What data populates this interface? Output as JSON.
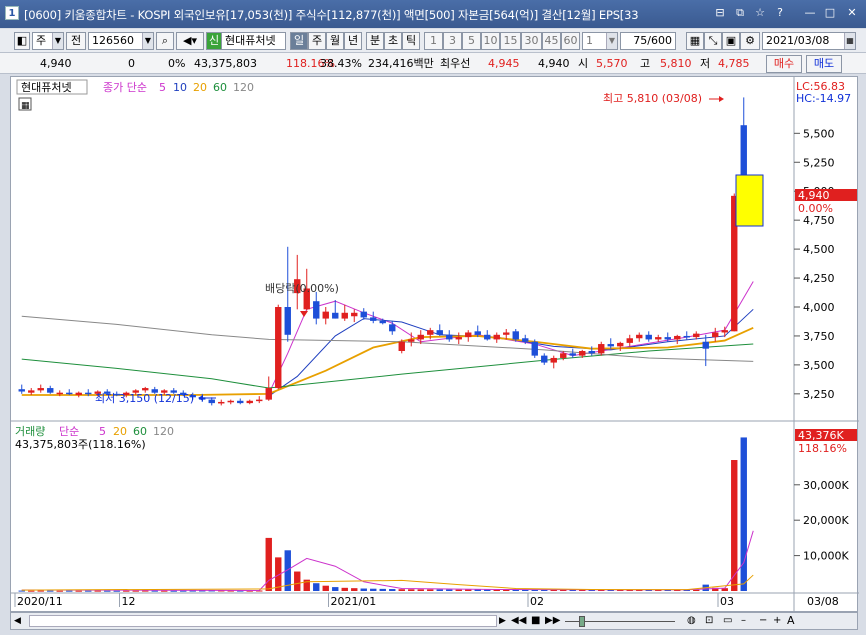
{
  "window": {
    "badge": "1",
    "title": "[0600] 키움종합차트 - KOSPI 외국인보유[17,053(천)] 주식수[112,877(천)] 액면[500] 자본금[564(억)] 결산[12월] EPS[33",
    "controls": [
      "⊟",
      "⧉",
      "☆",
      "?",
      "—",
      "□",
      "✕"
    ]
  },
  "toolbar": {
    "period": "주",
    "prev": "전",
    "code": "126560",
    "new_badge": "신",
    "stock_name": "현대퓨처넷",
    "intervals": [
      "일",
      "주",
      "월",
      "년",
      "분",
      "초",
      "틱"
    ],
    "numbers": [
      "1",
      "3",
      "5",
      "10",
      "15",
      "30",
      "45",
      "60"
    ],
    "count_value": "1",
    "page_count": "75/600",
    "date": "2021/03/08"
  },
  "summary": {
    "price": "4,940",
    "change": "0",
    "change_pct": "0%",
    "volume": "43,375,803",
    "vol_ratio": "118.16%",
    "turnover": "38.43%",
    "amount": "234,416백만",
    "pref_label": "최우선",
    "ask": "4,945",
    "bid": "4,940",
    "open_label": "시",
    "open": "5,570",
    "high_label": "고",
    "high": "5,810",
    "low_label": "저",
    "low": "4,785",
    "buy_label": "매수",
    "sell_label": "매도"
  },
  "price_panel": {
    "stock_tab": "현대퓨처넷",
    "ma_title": "종가 단순",
    "ma_periods": [
      "5",
      "10",
      "20",
      "60",
      "120"
    ],
    "lc": "LC:56.83",
    "hc": "HC:-14.97",
    "current_price": "4,940",
    "current_pct": "0.00%",
    "high_annotation": "최고 5,810 (03/08)",
    "low_annotation": "최저 3,150 (12/15)",
    "event_annotation": "배당락(0.00%)",
    "y_ticks": [
      "5,500",
      "5,250",
      "5,000",
      "4,750",
      "4,500",
      "4,250",
      "4,000",
      "3,750",
      "3,500",
      "3,250"
    ]
  },
  "volume_panel": {
    "title": "거래량",
    "ma_title": "단순",
    "ma_periods": [
      "5",
      "20",
      "60",
      "120"
    ],
    "info": "43,375,803주(118.16%)",
    "current_value": "43,376K",
    "current_pct": "118.16%",
    "y_ticks": [
      "30,000K",
      "20,000K",
      "10,000K"
    ]
  },
  "x_axis": {
    "labels": [
      "2020/11",
      "12",
      "2021/01",
      "02",
      "03",
      "03/08"
    ]
  },
  "colors": {
    "up": "#e0201f",
    "down": "#1e4fd8",
    "ma5": "#cc33cc",
    "ma10": "#1f3fbf",
    "ma20": "#e8a000",
    "ma60": "#1e8f3c",
    "ma120": "#888888"
  },
  "chart_data": {
    "type": "candlestick",
    "ohlc": [
      [
        3290,
        3330,
        3250,
        3270
      ],
      [
        3260,
        3300,
        3240,
        3280
      ],
      [
        3280,
        3330,
        3260,
        3300
      ],
      [
        3300,
        3320,
        3250,
        3260
      ],
      [
        3250,
        3280,
        3230,
        3260
      ],
      [
        3260,
        3290,
        3240,
        3250
      ],
      [
        3240,
        3270,
        3220,
        3260
      ],
      [
        3260,
        3290,
        3230,
        3250
      ],
      [
        3250,
        3280,
        3230,
        3270
      ],
      [
        3270,
        3290,
        3240,
        3250
      ],
      [
        3250,
        3270,
        3230,
        3240
      ],
      [
        3240,
        3270,
        3220,
        3260
      ],
      [
        3260,
        3290,
        3240,
        3280
      ],
      [
        3280,
        3310,
        3260,
        3300
      ],
      [
        3290,
        3310,
        3250,
        3260
      ],
      [
        3260,
        3290,
        3240,
        3280
      ],
      [
        3280,
        3300,
        3250,
        3260
      ],
      [
        3260,
        3280,
        3230,
        3240
      ],
      [
        3240,
        3260,
        3200,
        3220
      ],
      [
        3220,
        3250,
        3180,
        3200
      ],
      [
        3200,
        3220,
        3150,
        3170
      ],
      [
        3170,
        3200,
        3150,
        3180
      ],
      [
        3180,
        3200,
        3160,
        3190
      ],
      [
        3190,
        3210,
        3160,
        3170
      ],
      [
        3170,
        3200,
        3160,
        3190
      ],
      [
        3190,
        3230,
        3170,
        3200
      ],
      [
        3200,
        3400,
        3190,
        3300
      ],
      [
        3300,
        4020,
        3290,
        4000
      ],
      [
        4000,
        4520,
        3700,
        3760
      ],
      [
        4120,
        4450,
        3980,
        4240
      ],
      [
        3980,
        4330,
        3970,
        4160
      ],
      [
        4050,
        4130,
        3850,
        3900
      ],
      [
        3900,
        4000,
        3850,
        3960
      ],
      [
        3950,
        4060,
        3900,
        3900
      ],
      [
        3900,
        4020,
        3880,
        3950
      ],
      [
        3920,
        3980,
        3870,
        3950
      ],
      [
        3960,
        3990,
        3890,
        3910
      ],
      [
        3910,
        3960,
        3860,
        3880
      ],
      [
        3880,
        3900,
        3850,
        3860
      ],
      [
        3850,
        3880,
        3760,
        3790
      ],
      [
        3620,
        3720,
        3600,
        3700
      ],
      [
        3700,
        3780,
        3660,
        3720
      ],
      [
        3720,
        3800,
        3680,
        3760
      ],
      [
        3760,
        3820,
        3720,
        3800
      ],
      [
        3800,
        3850,
        3750,
        3760
      ],
      [
        3760,
        3800,
        3700,
        3720
      ],
      [
        3720,
        3780,
        3680,
        3740
      ],
      [
        3740,
        3800,
        3700,
        3780
      ],
      [
        3790,
        3840,
        3740,
        3760
      ],
      [
        3760,
        3800,
        3710,
        3720
      ],
      [
        3720,
        3780,
        3690,
        3760
      ],
      [
        3760,
        3810,
        3720,
        3780
      ],
      [
        3790,
        3810,
        3700,
        3720
      ],
      [
        3730,
        3760,
        3680,
        3700
      ],
      [
        3700,
        3720,
        3560,
        3580
      ],
      [
        3580,
        3600,
        3500,
        3520
      ],
      [
        3520,
        3580,
        3470,
        3560
      ],
      [
        3560,
        3620,
        3540,
        3600
      ],
      [
        3600,
        3640,
        3560,
        3580
      ],
      [
        3580,
        3630,
        3560,
        3620
      ],
      [
        3620,
        3660,
        3580,
        3600
      ],
      [
        3600,
        3700,
        3580,
        3680
      ],
      [
        3680,
        3730,
        3640,
        3660
      ],
      [
        3660,
        3700,
        3620,
        3690
      ],
      [
        3690,
        3760,
        3660,
        3730
      ],
      [
        3730,
        3780,
        3700,
        3760
      ],
      [
        3760,
        3790,
        3700,
        3720
      ],
      [
        3720,
        3760,
        3700,
        3740
      ],
      [
        3740,
        3780,
        3700,
        3720
      ],
      [
        3720,
        3760,
        3680,
        3750
      ],
      [
        3750,
        3790,
        3720,
        3740
      ],
      [
        3740,
        3790,
        3720,
        3770
      ],
      [
        3700,
        3760,
        3490,
        3640
      ],
      [
        3740,
        3820,
        3700,
        3780
      ],
      [
        3780,
        3830,
        3740,
        3800
      ],
      [
        3790,
        4980,
        3790,
        4960
      ],
      [
        5570,
        5810,
        4785,
        4940
      ]
    ],
    "volume_k": [
      120,
      90,
      110,
      100,
      80,
      95,
      85,
      90,
      100,
      85,
      80,
      90,
      95,
      110,
      100,
      90,
      85,
      95,
      120,
      140,
      160,
      150,
      130,
      120,
      110,
      140,
      15000,
      9500,
      11500,
      5500,
      3200,
      2200,
      1500,
      1100,
      900,
      800,
      700,
      650,
      600,
      550,
      500,
      480,
      460,
      440,
      420,
      400,
      380,
      400,
      420,
      380,
      360,
      340,
      330,
      320,
      340,
      360,
      350,
      330,
      320,
      340,
      360,
      380,
      400,
      380,
      360,
      340,
      330,
      350,
      340,
      330,
      350,
      360,
      1800,
      900,
      800,
      37000,
      43376
    ],
    "ma": {
      "ma5": [
        [
          26,
          3250
        ],
        [
          28,
          3600
        ],
        [
          30,
          3980
        ],
        [
          33,
          4050
        ],
        [
          36,
          3950
        ],
        [
          39,
          3860
        ],
        [
          42,
          3700
        ],
        [
          48,
          3760
        ],
        [
          54,
          3680
        ],
        [
          58,
          3580
        ],
        [
          64,
          3660
        ],
        [
          70,
          3740
        ],
        [
          74,
          3800
        ],
        [
          77,
          4220
        ]
      ],
      "ma10": [
        [
          26,
          3230
        ],
        [
          29,
          3400
        ],
        [
          33,
          3750
        ],
        [
          36,
          3900
        ],
        [
          40,
          3870
        ],
        [
          44,
          3760
        ],
        [
          50,
          3740
        ],
        [
          56,
          3660
        ],
        [
          62,
          3630
        ],
        [
          68,
          3700
        ],
        [
          74,
          3750
        ],
        [
          77,
          3980
        ]
      ],
      "ma20": [
        [
          0,
          3240
        ],
        [
          18,
          3240
        ],
        [
          26,
          3250
        ],
        [
          32,
          3450
        ],
        [
          37,
          3650
        ],
        [
          42,
          3740
        ],
        [
          48,
          3750
        ],
        [
          54,
          3700
        ],
        [
          60,
          3640
        ],
        [
          68,
          3650
        ],
        [
          74,
          3710
        ],
        [
          77,
          3820
        ]
      ],
      "ma60": [
        [
          0,
          3550
        ],
        [
          10,
          3470
        ],
        [
          20,
          3380
        ],
        [
          26,
          3300
        ],
        [
          40,
          3420
        ],
        [
          55,
          3540
        ],
        [
          66,
          3620
        ],
        [
          77,
          3680
        ]
      ],
      "ma120": [
        [
          0,
          3920
        ],
        [
          10,
          3850
        ],
        [
          20,
          3760
        ],
        [
          26,
          3720
        ],
        [
          40,
          3700
        ],
        [
          55,
          3630
        ],
        [
          66,
          3560
        ],
        [
          77,
          3530
        ]
      ]
    },
    "vol_ma": {
      "vma5": [
        [
          0,
          300
        ],
        [
          25,
          150
        ],
        [
          26,
          3000
        ],
        [
          28,
          6000
        ],
        [
          30,
          9200
        ],
        [
          33,
          7000
        ],
        [
          36,
          2600
        ],
        [
          40,
          700
        ],
        [
          50,
          420
        ],
        [
          60,
          370
        ],
        [
          70,
          360
        ],
        [
          74,
          800
        ],
        [
          76,
          8000
        ],
        [
          77,
          17000
        ]
      ],
      "vma20": [
        [
          0,
          260
        ],
        [
          26,
          600
        ],
        [
          30,
          2600
        ],
        [
          40,
          3000
        ],
        [
          46,
          1800
        ],
        [
          52,
          700
        ],
        [
          60,
          420
        ],
        [
          70,
          380
        ],
        [
          76,
          2000
        ],
        [
          77,
          4500
        ]
      ]
    },
    "price_range": [
      3050,
      5900
    ],
    "volume_range": [
      0,
      43500
    ]
  }
}
